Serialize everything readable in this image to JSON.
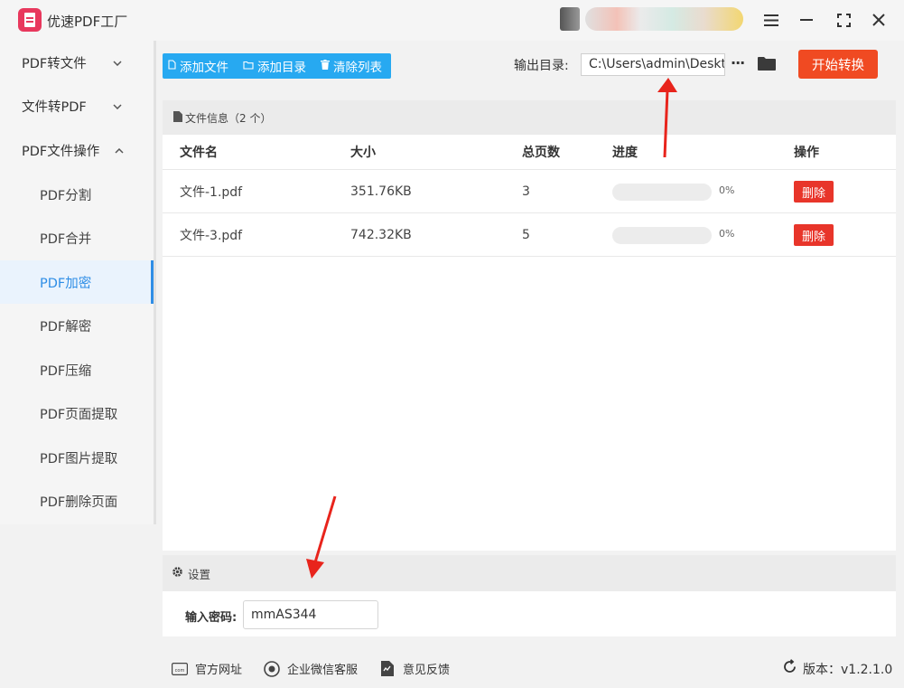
{
  "titlebar": {
    "app_title": "优速PDF工厂",
    "logo_icon": "pdf-logo-icon",
    "menu_icon": "menu-icon",
    "minimize_icon": "minimize-icon",
    "maximize_icon": "maximize-icon",
    "close_icon": "close-icon"
  },
  "sidebar": {
    "groups": [
      {
        "label": "PDF转文件",
        "chevron": "chevron-down"
      },
      {
        "label": "文件转PDF",
        "chevron": "chevron-down"
      },
      {
        "label": "PDF文件操作",
        "chevron": "chevron-up"
      }
    ],
    "sub_items": [
      {
        "label": "PDF分割"
      },
      {
        "label": "PDF合并"
      },
      {
        "label": "PDF加密",
        "active": true
      },
      {
        "label": "PDF解密"
      },
      {
        "label": "PDF压缩"
      },
      {
        "label": "PDF页面提取"
      },
      {
        "label": "PDF图片提取"
      },
      {
        "label": "PDF删除页面"
      }
    ]
  },
  "toolbar": {
    "add_file": "添加文件",
    "add_folder": "添加目录",
    "clear_list": "清除列表",
    "output_label": "输出目录:",
    "output_path": "C:\\Users\\admin\\Desktop",
    "more": "···",
    "start": "开始转换"
  },
  "file_panel": {
    "header": "文件信息（2 个）",
    "columns": {
      "name": "文件名",
      "size": "大小",
      "pages": "总页数",
      "progress": "进度",
      "action": "操作"
    },
    "rows": [
      {
        "name": "文件-1.pdf",
        "size": "351.76KB",
        "pages": "3",
        "progress": 0,
        "progress_text": "0%",
        "action": "删除"
      },
      {
        "name": "文件-3.pdf",
        "size": "742.32KB",
        "pages": "5",
        "progress": 0,
        "progress_text": "0%",
        "action": "删除"
      }
    ]
  },
  "settings": {
    "header": "设置",
    "password_label": "输入密码:",
    "password_value": "mmAS344"
  },
  "footer": {
    "website": "官方网址",
    "wechat": "企业微信客服",
    "feedback": "意见反馈",
    "version": "版本：v1.2.1.0"
  },
  "colors": {
    "accent_blue": "#27a9f1",
    "start_red": "#f04a22",
    "delete_red": "#e8352a",
    "active_text": "#2f8ee6",
    "annotation_red": "#e8241c"
  }
}
